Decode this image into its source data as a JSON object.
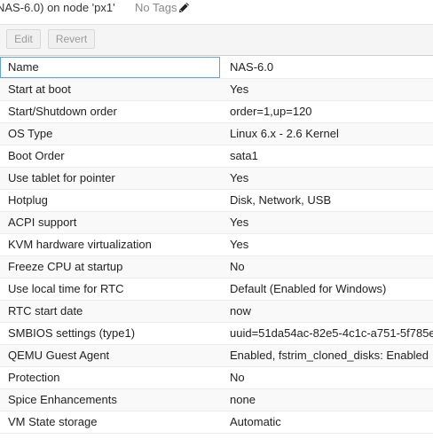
{
  "header": {
    "title": "NAS-6.0) on node 'px1'",
    "tags_label": "No Tags",
    "edit_tags_icon": "pencil-icon"
  },
  "toolbar": {
    "edit_label": "Edit",
    "revert_label": "Revert"
  },
  "options": [
    {
      "key": "Name",
      "value": "NAS-6.0"
    },
    {
      "key": "Start at boot",
      "value": "Yes"
    },
    {
      "key": "Start/Shutdown order",
      "value": "order=1,up=120"
    },
    {
      "key": "OS Type",
      "value": "Linux 6.x - 2.6 Kernel"
    },
    {
      "key": "Boot Order",
      "value": "sata1"
    },
    {
      "key": "Use tablet for pointer",
      "value": "Yes"
    },
    {
      "key": "Hotplug",
      "value": "Disk, Network, USB"
    },
    {
      "key": "ACPI support",
      "value": "Yes"
    },
    {
      "key": "KVM hardware virtualization",
      "value": "Yes"
    },
    {
      "key": "Freeze CPU at startup",
      "value": "No"
    },
    {
      "key": "Use local time for RTC",
      "value": "Default (Enabled for Windows)"
    },
    {
      "key": "RTC start date",
      "value": "now"
    },
    {
      "key": "SMBIOS settings (type1)",
      "value": "uuid=51da54ac-82e5-4c1c-a751-5f785e"
    },
    {
      "key": "QEMU Guest Agent",
      "value": "Enabled, fstrim_cloned_disks: Enabled"
    },
    {
      "key": "Protection",
      "value": "No"
    },
    {
      "key": "Spice Enhancements",
      "value": "none"
    },
    {
      "key": "VM State storage",
      "value": "Automatic"
    }
  ],
  "colors": {
    "selection_border": "#5fa2dd",
    "disabled_text": "#9a9a9a"
  }
}
